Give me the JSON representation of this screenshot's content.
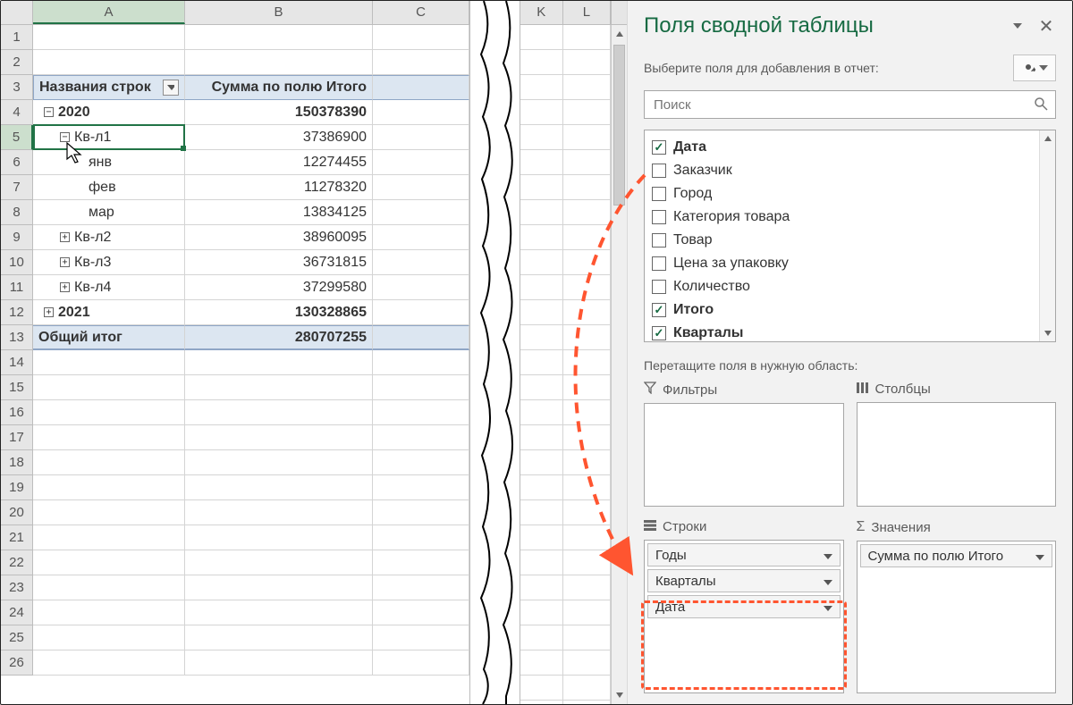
{
  "sheet": {
    "columns": [
      "A",
      "B",
      "C"
    ],
    "mid_columns": [
      "K",
      "L"
    ],
    "header": {
      "rowLabels": "Названия строк",
      "valueCol": "Сумма по полю Итого"
    },
    "rows": [
      {
        "n": 1,
        "a": "",
        "b": ""
      },
      {
        "n": 2,
        "a": "",
        "b": ""
      },
      {
        "n": 3,
        "type": "hdr"
      },
      {
        "n": 4,
        "exp": "minus",
        "indent": 1,
        "a": "2020",
        "b": "150378390",
        "bold": true
      },
      {
        "n": 5,
        "exp": "minus",
        "indent": 2,
        "a": "Кв-л1",
        "b": "37386900",
        "selected": true
      },
      {
        "n": 6,
        "indent": 3,
        "a": "янв",
        "b": "12274455"
      },
      {
        "n": 7,
        "indent": 3,
        "a": "фев",
        "b": "11278320"
      },
      {
        "n": 8,
        "indent": 3,
        "a": "мар",
        "b": "13834125"
      },
      {
        "n": 9,
        "exp": "plus",
        "indent": 2,
        "a": "Кв-л2",
        "b": "38960095"
      },
      {
        "n": 10,
        "exp": "plus",
        "indent": 2,
        "a": "Кв-л3",
        "b": "36731815"
      },
      {
        "n": 11,
        "exp": "plus",
        "indent": 2,
        "a": "Кв-л4",
        "b": "37299580"
      },
      {
        "n": 12,
        "exp": "plus",
        "indent": 1,
        "a": "2021",
        "b": "130328865",
        "bold": true
      },
      {
        "n": 13,
        "type": "total",
        "a": "Общий итог",
        "b": "280707255"
      },
      {
        "n": 14
      },
      {
        "n": 15
      },
      {
        "n": 16
      },
      {
        "n": 17
      },
      {
        "n": 18
      },
      {
        "n": 19
      },
      {
        "n": 20
      },
      {
        "n": 21
      },
      {
        "n": 22
      },
      {
        "n": 23
      },
      {
        "n": 24
      },
      {
        "n": 25
      },
      {
        "n": 26
      }
    ]
  },
  "panel": {
    "title": "Поля сводной таблицы",
    "subtitle": "Выберите поля для добавления в отчет:",
    "search_placeholder": "Поиск",
    "fields": [
      {
        "label": "Дата",
        "checked": true,
        "bold": true
      },
      {
        "label": "Заказчик",
        "checked": false
      },
      {
        "label": "Город",
        "checked": false
      },
      {
        "label": "Категория товара",
        "checked": false
      },
      {
        "label": "Товар",
        "checked": false
      },
      {
        "label": "Цена за упаковку",
        "checked": false
      },
      {
        "label": "Количество",
        "checked": false
      },
      {
        "label": "Итого",
        "checked": true,
        "bold": true
      },
      {
        "label": "Кварталы",
        "checked": true,
        "bold": true
      }
    ],
    "drag_hint": "Перетащите поля в нужную область:",
    "zones": {
      "filters": "Фильтры",
      "columns": "Столбцы",
      "rows": "Строки",
      "values": "Значения"
    },
    "rows_items": [
      "Годы",
      "Кварталы",
      "Дата"
    ],
    "values_items": [
      "Сумма по полю Итого"
    ]
  }
}
